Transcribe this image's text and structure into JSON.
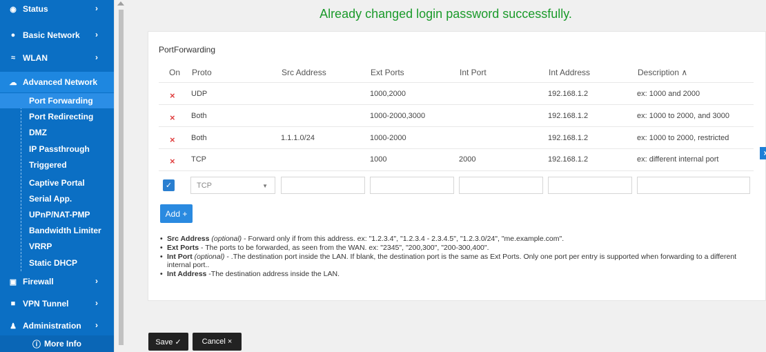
{
  "sidebar": {
    "sections": [
      {
        "label": "Status",
        "icon": "eye-icon",
        "glyph": "◉"
      },
      {
        "label": "Basic Network",
        "icon": "globe-icon",
        "glyph": "●"
      },
      {
        "label": "WLAN",
        "icon": "wifi-icon",
        "glyph": "≈"
      },
      {
        "label": "Advanced Network",
        "icon": "cloud-icon",
        "glyph": "☁"
      },
      {
        "label": "Firewall",
        "icon": "firewall-icon",
        "glyph": "▣"
      },
      {
        "label": "VPN Tunnel",
        "icon": "vpn-icon",
        "glyph": "■"
      },
      {
        "label": "Administration",
        "icon": "admin-icon",
        "glyph": "♟"
      }
    ],
    "sub_items": [
      "Port Forwarding",
      "Port Redirecting",
      "DMZ",
      "IP Passthrough",
      "Triggered",
      "Captive Portal",
      "Serial App.",
      "UPnP/NAT-PMP",
      "Bandwidth Limiter",
      "VRRP",
      "Static DHCP"
    ],
    "more_info": "More Info"
  },
  "message": "Already changed login password successfully.",
  "card": {
    "title": "PortForwarding",
    "columns": [
      "On",
      "Proto",
      "Src Address",
      "Ext Ports",
      "Int Port",
      "Int Address",
      "Description ∧"
    ],
    "rows": [
      {
        "on": "×",
        "proto": "UDP",
        "src": "",
        "ext": "1000,2000",
        "int_port": "",
        "int_addr": "192.168.1.2",
        "desc": "ex: 1000 and 2000"
      },
      {
        "on": "×",
        "proto": "Both",
        "src": "",
        "ext": "1000-2000,3000",
        "int_port": "",
        "int_addr": "192.168.1.2",
        "desc": "ex: 1000 to 2000, and 3000"
      },
      {
        "on": "×",
        "proto": "Both",
        "src": "1.1.1.0/24",
        "ext": "1000-2000",
        "int_port": "",
        "int_addr": "192.168.1.2",
        "desc": "ex: 1000 to 2000, restricted"
      },
      {
        "on": "×",
        "proto": "TCP",
        "src": "",
        "ext": "1000",
        "int_port": "2000",
        "int_addr": "192.168.1.2",
        "desc": "ex: different internal port"
      }
    ],
    "new_row": {
      "proto": "TCP",
      "src": "",
      "ext": "",
      "int_port": "",
      "int_addr": "",
      "desc": ""
    },
    "add_label": "Add +",
    "notes": [
      {
        "term": "Src Address",
        "qual": "(optional)",
        "text": " - Forward only if from this address. ex: \"1.2.3.4\", \"1.2.3.4 - 2.3.4.5\", \"1.2.3.0/24\", \"me.example.com\"."
      },
      {
        "term": "Ext Ports",
        "qual": "",
        "text": " - The ports to be forwarded, as seen from the WAN. ex: \"2345\", \"200,300\", \"200-300,400\"."
      },
      {
        "term": "Int Port",
        "qual": "(optional)",
        "text": " - .The destination port inside the LAN. If blank, the destination port is the same as Ext Ports. Only one port per entry is supported when forwarding to a different internal port.."
      },
      {
        "term": "Int Address",
        "qual": "",
        "text": " -The destination address inside the LAN."
      }
    ]
  },
  "footer": {
    "save": "Save ✓",
    "cancel": "Cancel ×"
  }
}
